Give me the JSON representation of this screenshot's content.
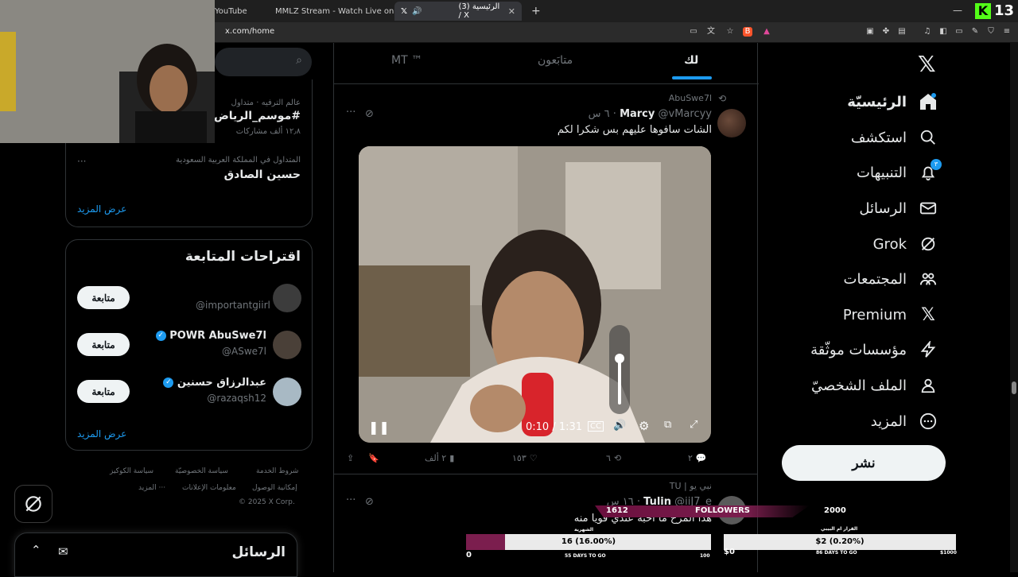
{
  "browser": {
    "tabs": [
      {
        "label": "YouTube",
        "active": false
      },
      {
        "label": "MMLZ Stream - Watch Live on Kick",
        "active": false
      },
      {
        "label": "(3) الرئيسية / X",
        "active": true
      }
    ],
    "new_tab": "+",
    "url": "x.com/home",
    "kick_count": "13"
  },
  "nav": {
    "items": [
      {
        "label": "الرئيسيّة",
        "icon": "home-icon"
      },
      {
        "label": "استكشف",
        "icon": "search-icon"
      },
      {
        "label": "التنبيهات",
        "icon": "bell-icon",
        "badge": "٣"
      },
      {
        "label": "الرسائل",
        "icon": "mail-icon"
      },
      {
        "label": "Grok",
        "icon": "grok-icon"
      },
      {
        "label": "المجتمعات",
        "icon": "communities-icon"
      },
      {
        "label": "Premium",
        "icon": "x-icon"
      },
      {
        "label": "مؤسسات موثّقة",
        "icon": "lightning-icon"
      },
      {
        "label": "الملف الشخصيّ",
        "icon": "person-icon"
      },
      {
        "label": "المزيد",
        "icon": "more-icon"
      }
    ],
    "post_label": "نشر"
  },
  "feed": {
    "tabs": [
      "لك",
      "متابَعون",
      "MT ™"
    ],
    "tweet1": {
      "repost_by": "AbuSwe7l",
      "name": "Marcy",
      "handle": "@vMarcyy",
      "time": "٦ س",
      "text": "الشات سافوها عليهم بس شكرا لكم",
      "video_time": "0:10 / 1:31",
      "replies": "٢",
      "reposts": "٦",
      "likes": "١٥٣",
      "views": "٢ ألف"
    },
    "tweet2": {
      "repost_by": "نبي يو | TU",
      "name": "Tulin",
      "handle": "@iiJ7_e",
      "time": "١٦ س",
      "text": "هذا المرح ما احبه عندي قويا منه"
    }
  },
  "sidebar": {
    "search_placeholder": "",
    "trends": [
      {
        "meta": "عالم الترفيه · متداول",
        "title": "#موسم_الرياض",
        "count": "١٢٫٨ ألف مشاركات"
      },
      {
        "meta": "المتداول في المملكة العربية السعودية",
        "title": "حسين الصادق",
        "count": ""
      }
    ],
    "show_more": "عرض المزيد",
    "suggestions_title": "اقتراحات المتابعة",
    "suggestions": [
      {
        "name": "",
        "handle": "@importantgiirl",
        "verified": false
      },
      {
        "name": "POWR AbuSwe7l",
        "handle": "@ASwe7l",
        "verified": true
      },
      {
        "name": "عبدالرزاق حسنين",
        "handle": "@razaqsh12",
        "verified": true
      }
    ],
    "follow_label": "متابعة",
    "show_more2": "عرض المزيد",
    "footer": [
      "شروط الخدمة",
      "سياسة الخصوصيّة",
      "سياسة الكوكيز",
      "إمكانية الوصول",
      "معلومات الإعلانات",
      "··· المزيد",
      "© 2025 X Corp."
    ]
  },
  "messages": {
    "title": "الرسائل"
  },
  "overlay": {
    "followers_label": "FOLLOWERS",
    "followers_current": "1612",
    "followers_goal": "2000",
    "sub_bar_text": "16 (16.00%)",
    "sub_min": "0",
    "sub_max": "100",
    "sub_days": "55 DAYS TO GO",
    "sub_fill": 0.16,
    "sub_title": "الشهرية",
    "dono_bar_text": "$2 (0.20%)",
    "dono_min": "$0",
    "dono_max": "$1000",
    "dono_days": "86 DAYS TO GO",
    "dono_title": "القرار ام البيبي",
    "accent": "#7b1e4e"
  }
}
